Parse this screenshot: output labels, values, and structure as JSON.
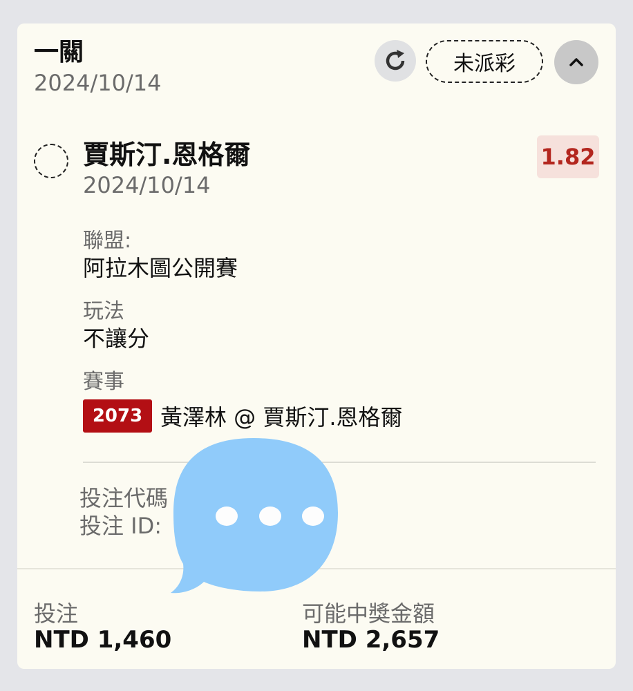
{
  "header": {
    "title": "一關",
    "date": "2024/10/14",
    "status_label": "未派彩"
  },
  "selection": {
    "name": "賈斯汀.恩格爾",
    "date": "2024/10/14",
    "odds": "1.82"
  },
  "details": {
    "league_label": "聯盟:",
    "league_value": "阿拉木圖公開賽",
    "play_label": "玩法",
    "play_value": "不讓分",
    "event_label": "賽事",
    "event_code": "2073",
    "event_text": "黃澤林 @ 賈斯汀.恩格爾",
    "bet_code_label": "投注代碼",
    "bet_id_label": "投注 ID:"
  },
  "footer": {
    "stake_label": "投注",
    "stake_value": "NTD 1,460",
    "payout_label": "可能中獎金額",
    "payout_value": "NTD 2,657"
  },
  "icons": {
    "refresh": "refresh-icon",
    "collapse": "chevron-up-icon",
    "overlay": "chat-bubble-icon"
  },
  "colors": {
    "card_bg": "#fcfbf2",
    "odds_text": "#b3261e",
    "odds_bg": "#f6e1dc",
    "event_code_bg": "#b30f14",
    "overlay": "#90cbfa"
  }
}
